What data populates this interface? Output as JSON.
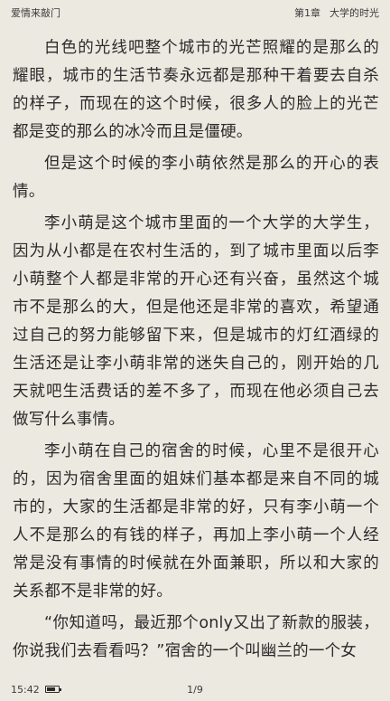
{
  "header": {
    "book_title": "爱情来敲门",
    "chapter_number": "第1章",
    "chapter_title": "大学的时光"
  },
  "content": {
    "paragraphs": [
      "白色的光线吧整个城市的光芒照耀的是那么的耀眼，城市的生活节奏永远都是那种干着要去自杀的样子，而现在的这个时候，很多人的脸上的光芒都是变的那么的冰冷而且是僵硬。",
      "但是这个时候的李小萌依然是那么的开心的表情。",
      "李小萌是这个城市里面的一个大学的大学生，因为从小都是在农村生活的，到了城市里面以后李小萌整个人都是非常的开心还有兴奋，虽然这个城市不是那么的大，但是他还是非常的喜欢，希望通过自己的努力能够留下来，但是城市的灯红酒绿的生活还是让李小萌非常的迷失自己的，刚开始的几天就吧生活费话的差不多了，而现在他必须自己去做写什么事情。",
      "李小萌在自己的宿舍的时候，心里不是很开心的，因为宿舍里面的姐妹们基本都是来自不同的城市的，大家的生活都是非常的好，只有李小萌一个人不是那么的有钱的样子，再加上李小萌一个人经常是没有事情的时候就在外面兼职，所以和大家的关系都不是非常的好。",
      "“你知道吗，最近那个only又出了新款的服装，你说我们去看看吗？”宿舍的一个叫幽兰的一个女"
    ]
  },
  "footer": {
    "time": "15:42",
    "battery_level": 0.75,
    "page_indicator": "1/9"
  }
}
